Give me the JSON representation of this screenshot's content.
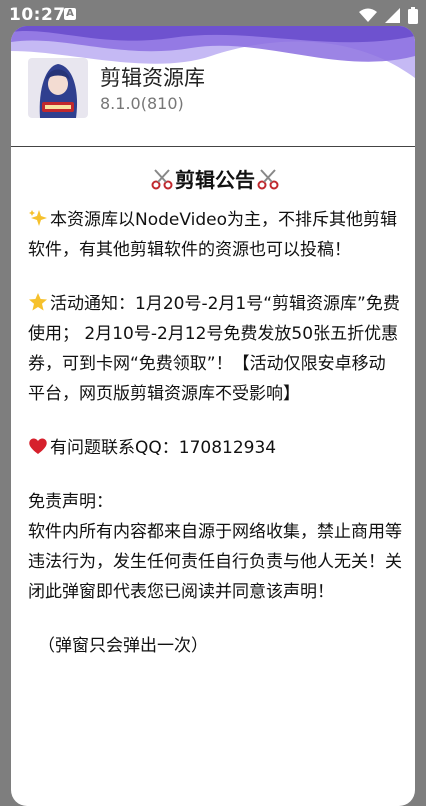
{
  "status_bar": {
    "time": "10:27",
    "notification_icon": "a-notification-icon",
    "icons": [
      "wifi-icon",
      "signal-icon",
      "battery-icon"
    ]
  },
  "dialog": {
    "app_name": "剪辑资源库",
    "app_version": "8.1.0(810)",
    "notice_title": "剪辑公告",
    "para1": "本资源库以NodeVideo为主，不排斥其他剪辑软件，有其他剪辑软件的资源也可以投稿！",
    "para2": "活动通知：1月20号-2月1号“剪辑资源库”免费使用； 2月10号-2月12号免费发放50张五折优惠券，可到卡网“免费领取”！【活动仅限安卓移动平台，网页版剪辑资源库不受影响】",
    "para3": "有问题联系QQ：170812934",
    "disclaimer_title": "免责声明：",
    "disclaimer_body": "软件内所有内容都来自源于网络收集，禁止商用等违法行为，发生任何责任自行负责与他人无关！关闭此弹窗即代表您已阅读并同意该声明！",
    "footer_note": "（弹窗只会弹出一次）"
  },
  "colors": {
    "wave_purple": "#8b6fe0",
    "heart_red": "#d6202c",
    "star_yellow": "#f6c12c"
  }
}
